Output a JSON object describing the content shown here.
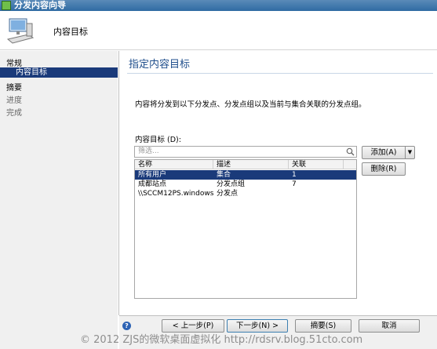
{
  "window": {
    "title": "分发内容向导"
  },
  "header": {
    "title": "内容目标"
  },
  "nav": [
    {
      "label": "常规"
    },
    {
      "label": "内容目标",
      "selected": true
    },
    {
      "label": "摘要"
    },
    {
      "label": "进度"
    },
    {
      "label": "完成"
    }
  ],
  "content": {
    "title": "指定内容目标",
    "description": "内容将分发到以下分发点、分发点组以及当前与集合关联的分发点组。",
    "targets_label": "内容目标 (D):",
    "filter_placeholder": "筛选...",
    "columns": [
      "名称",
      "描述",
      "关联"
    ],
    "rows": [
      [
        "所有用户",
        "集合",
        "1"
      ],
      [
        "成都站点",
        "分发点组",
        "7"
      ],
      [
        "\\\\SCCM12PS.windows...",
        "分发点",
        ""
      ]
    ]
  },
  "buttons": {
    "add": "添加(A)",
    "remove": "删除(R)",
    "prev": "< 上一步(P)",
    "next": "下一步(N) >",
    "summary": "摘要(S)",
    "cancel": "取消"
  },
  "watermark": "© 2012 ZJS的微软桌面虚拟化 http://rdsrv.blog.51cto.com",
  "colors": {
    "accent": "#1a3a7a",
    "title": "#1f4e8c"
  }
}
